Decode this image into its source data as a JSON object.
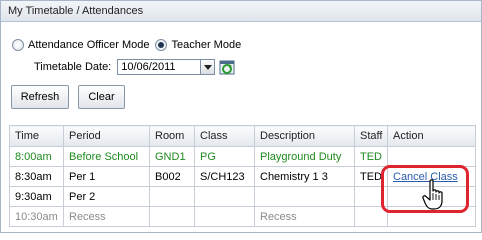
{
  "panel": {
    "title": "My Timetable / Attendances"
  },
  "mode": {
    "options": [
      {
        "label": "Attendance Officer Mode",
        "checked": false
      },
      {
        "label": "Teacher Mode",
        "checked": true
      }
    ]
  },
  "date": {
    "label": "Timetable Date:",
    "value": "10/06/2011"
  },
  "icons": {
    "dropdown": "chevron-down-icon",
    "calendar": "calendar-refresh-icon",
    "cursor": "hand-pointer-icon"
  },
  "buttons": {
    "refresh": "Refresh",
    "clear": "Clear"
  },
  "table": {
    "columns": [
      "Time",
      "Period",
      "Room",
      "Class",
      "Description",
      "Staff",
      "Action"
    ],
    "rows": [
      {
        "style": "green",
        "cells": [
          "8:00am",
          "Before School",
          "GND1",
          "PG",
          "Playground Duty",
          "TED",
          ""
        ]
      },
      {
        "style": "normal",
        "cells": [
          "8:30am",
          "Per 1",
          "B002",
          "S/CH123",
          "Chemistry 1 3",
          "TED",
          "Cancel Class"
        ]
      },
      {
        "style": "normal",
        "cells": [
          "9:30am",
          "Per 2",
          "",
          "",
          "",
          "",
          ""
        ]
      },
      {
        "style": "grey",
        "cells": [
          "10:30am",
          "Recess",
          "",
          "",
          "Recess",
          "",
          ""
        ]
      }
    ]
  },
  "colors": {
    "green_row": "#1f8a1f",
    "grey_row": "#8a8a8a",
    "highlight": "#e0242e",
    "link": "#2a5db0"
  }
}
